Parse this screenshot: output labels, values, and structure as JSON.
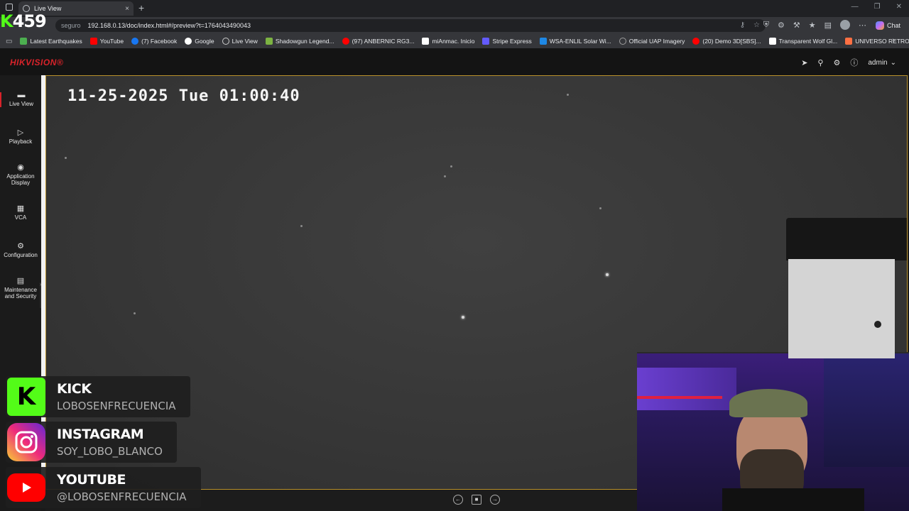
{
  "browser": {
    "tab_title": "Live View",
    "new_tab": "+",
    "close_tab": "×",
    "address_prefix": "seguro",
    "url": "192.168.0.13/doc/index.html#/preview?t=1764043490043",
    "chat_label": "Chat",
    "bookmarks": [
      {
        "label": "Latest Earthquakes",
        "color": "#4caf50"
      },
      {
        "label": "YouTube",
        "color": "#ff0000"
      },
      {
        "label": "(7) Facebook",
        "color": "#1877f2"
      },
      {
        "label": "Google",
        "color": "#ffffff"
      },
      {
        "label": "Live View",
        "color": "#cccccc"
      },
      {
        "label": "Shadowgun Legend...",
        "color": "#7cb342"
      },
      {
        "label": "(97) ANBERNIC RG3...",
        "color": "#ff0000"
      },
      {
        "label": "miAnmac. Inicio",
        "color": "#ffffff"
      },
      {
        "label": "Stripe Express",
        "color": "#635bff"
      },
      {
        "label": "WSA-ENLIL Solar Wi...",
        "color": "#1e88e5"
      },
      {
        "label": "Official UAP Imagery",
        "color": "#9e9e9e"
      },
      {
        "label": "(20) Demo 3D[SBS]...",
        "color": "#ff0000"
      },
      {
        "label": "Transparent Wolf Gl...",
        "color": "#ffffff"
      },
      {
        "label": "UNIVERSO RETRO...",
        "color": "#ff7043"
      }
    ]
  },
  "stream": {
    "kick_counter_k": "K",
    "kick_counter": "459"
  },
  "hikvision": {
    "brand": "HIKVISION®",
    "user": "admin",
    "osd_timestamp": "11-25-2025 Tue 01:00:40",
    "nav": [
      {
        "label": "Live View",
        "icon": "live-view-icon"
      },
      {
        "label": "Playback",
        "icon": "playback-icon"
      },
      {
        "label": "Application Display",
        "icon": "application-icon"
      },
      {
        "label": "VCA",
        "icon": "vca-icon"
      },
      {
        "label": "Configuration",
        "icon": "gear-icon"
      },
      {
        "label": "Maintenance and Security",
        "icon": "maintenance-icon"
      }
    ]
  },
  "socials": [
    {
      "name": "KICK",
      "handle": "LOBOSENFRECUENCIA",
      "color": "#53fc18"
    },
    {
      "name": "INSTAGRAM",
      "handle": "SOY_LOBO_BLANCO",
      "color": "#e1306c"
    },
    {
      "name": "YOUTUBE",
      "handle": "@LOBOSENFRECUENCIA",
      "color": "#ff0000"
    }
  ]
}
